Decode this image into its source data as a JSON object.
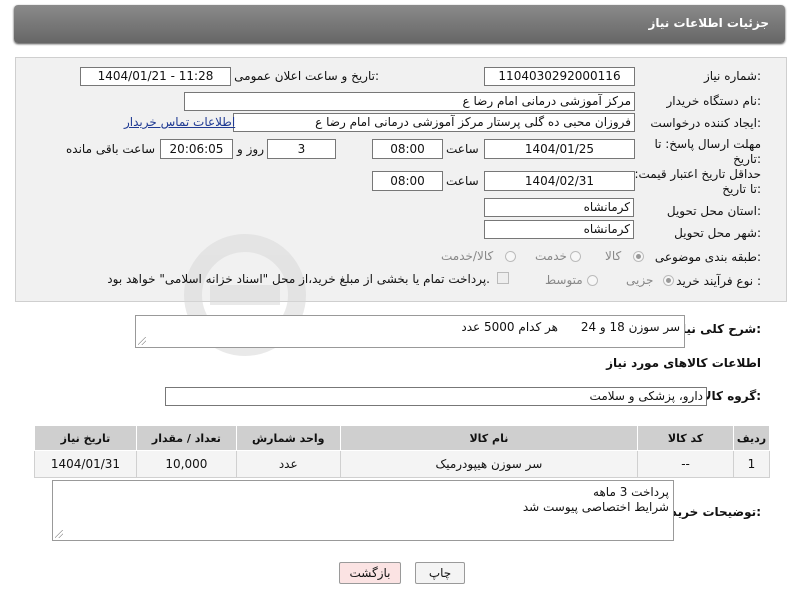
{
  "header": {
    "title": "جزئیات اطلاعات نیاز"
  },
  "form": {
    "need_number": {
      "label": "شماره نیاز:",
      "value": "1104030292000116"
    },
    "announce_datetime": {
      "label": "تاریخ و ساعت اعلان عمومی:",
      "value": "1404/01/21 - 11:28"
    },
    "buyer_org": {
      "label": "نام دستگاه خریدار:",
      "value": "مرکز آموزشی  درمانی امام رضا  ع"
    },
    "creator": {
      "label": "ایجاد کننده درخواست:",
      "value": "فروزان محبی ده گلی پرستار مرکز آموزشی  درمانی امام رضا  ع",
      "contact_link": "اطلاعات تماس خریدار"
    },
    "reply_deadline": {
      "label": "مهلت ارسال پاسخ: تا تاریخ:",
      "date": "1404/01/25",
      "time_label": "ساعت",
      "time": "08:00",
      "days": "3",
      "days_label": "روز و",
      "remaining": "20:06:05",
      "remaining_label": "ساعت باقی مانده"
    },
    "price_validity": {
      "label": "حداقل تاریخ اعتبار قیمت: تا تاریخ:",
      "date": "1404/02/31",
      "time_label": "ساعت",
      "time": "08:00"
    },
    "province": {
      "label": "استان محل تحویل:",
      "value": "کرمانشاه"
    },
    "city": {
      "label": "شهر محل تحویل:",
      "value": "کرمانشاه"
    },
    "category": {
      "label": "طبقه بندی موضوعی:",
      "options": [
        "کالا",
        "خدمت",
        "کالا/خدمت"
      ],
      "selected": "کالا"
    },
    "process_type": {
      "label": "نوع فرآیند خرید :",
      "options": [
        "جزیی",
        "متوسط"
      ],
      "selected": "جزیی",
      "payment_note": "پرداخت تمام یا بخشی از مبلغ خرید،از محل \"اسناد خزانه اسلامی\" خواهد بود."
    }
  },
  "summary": {
    "label": "شرح کلی نیاز:",
    "value": "سر سوزن 18 و 24      هر کدام 5000 عدد"
  },
  "goods_section": {
    "title": "اطلاعات کالاهای مورد نیاز",
    "group_label": "گروه کالا:",
    "group_value": "دارو، پزشکی و سلامت",
    "columns": [
      "ردیف",
      "کد کالا",
      "نام کالا",
      "واحد شمارش",
      "تعداد / مقدار",
      "تاریخ نیاز"
    ],
    "rows": [
      [
        "1",
        "--",
        "سر سوزن هیپودرمیک",
        "عدد",
        "10,000",
        "1404/01/31"
      ]
    ]
  },
  "buyer_notes": {
    "label": "توضیحات خریدار:",
    "lines": [
      "پرداخت 3 ماهه",
      "شرایط اختصاصی پیوست شد"
    ]
  },
  "buttons": {
    "print": "چاپ",
    "back": "بازگشت"
  },
  "colors": {
    "back_button_bg": "#fbe3e3",
    "print_button_bg": "#f4f4f4",
    "title_bar": "#777777",
    "panel_bg": "#f1f1f1"
  }
}
